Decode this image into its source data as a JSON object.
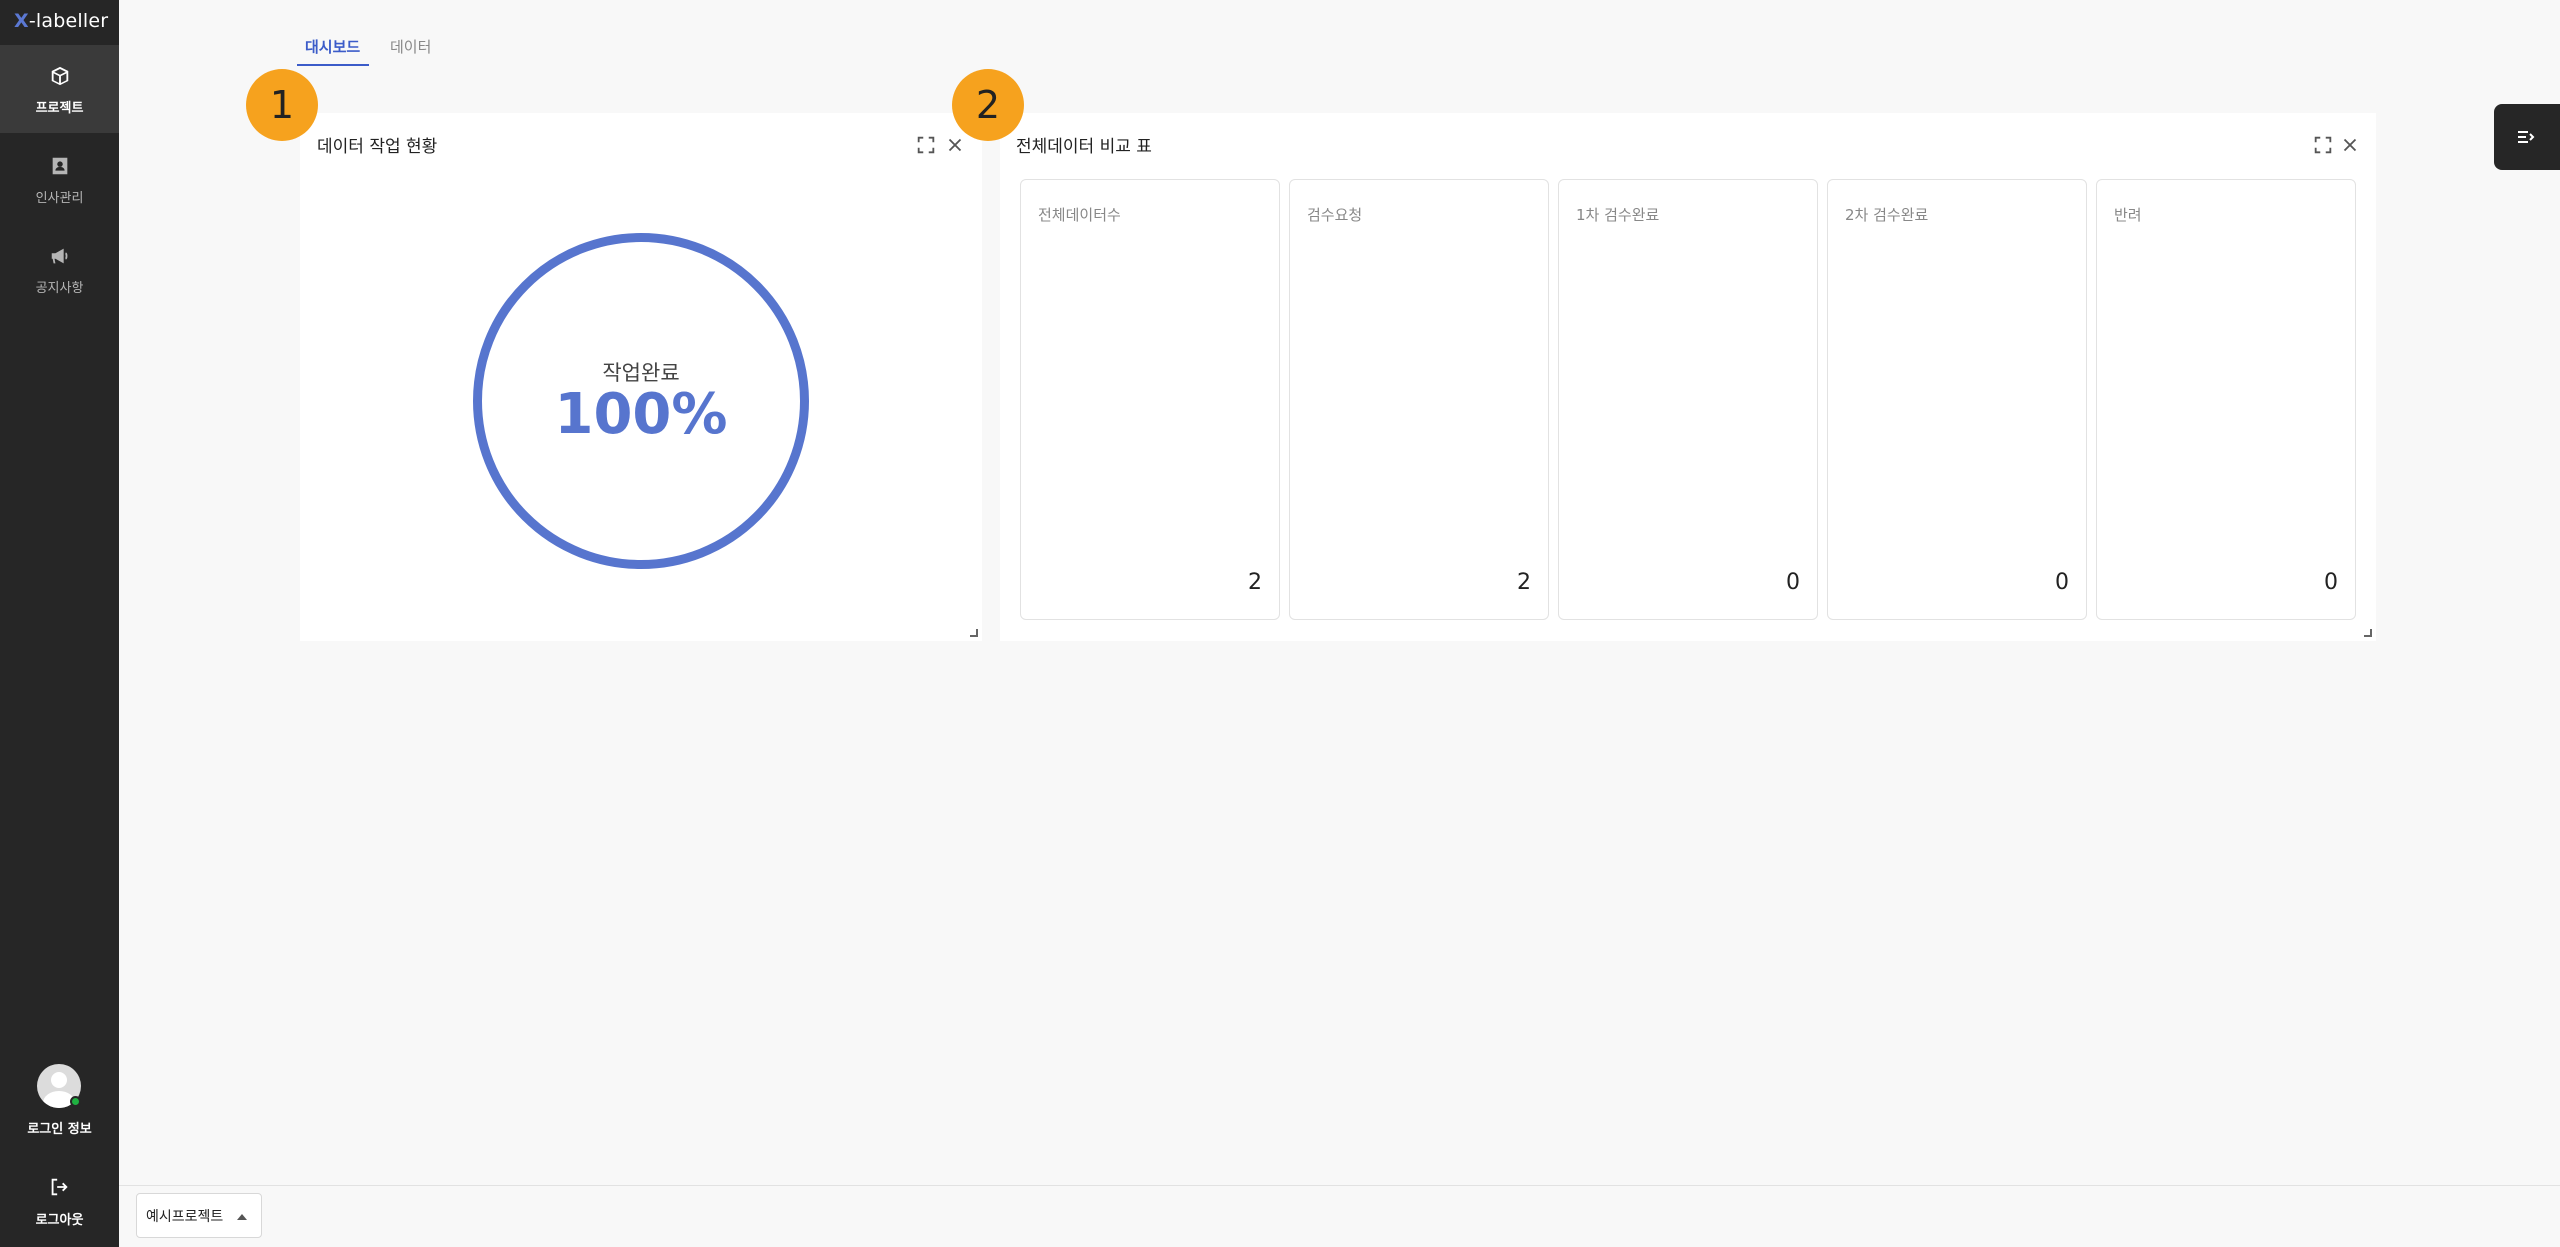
{
  "app": {
    "logo_prefix": "X",
    "logo_suffix": "-labeller",
    "brand_color": "#5b78d3"
  },
  "sidebar": {
    "items": [
      {
        "label": "프로젝트",
        "icon": "cube-icon",
        "active": true
      },
      {
        "label": "인사관리",
        "icon": "person-badge-icon",
        "active": false
      },
      {
        "label": "공지사항",
        "icon": "megaphone-icon",
        "active": false
      }
    ],
    "login_label": "로그인 정보",
    "logout_label": "로그아웃",
    "status_color": "#1fb141"
  },
  "tabs": [
    {
      "label": "대시보드",
      "active": true
    },
    {
      "label": "데이터",
      "active": false
    }
  ],
  "panels": [
    {
      "badge": "1",
      "title": "데이터 작업 현황",
      "progress": {
        "label": "작업완료",
        "value": "100%",
        "fraction": 1.0,
        "color": "#5775ce"
      }
    },
    {
      "badge": "2",
      "title": "전체데이터 비교 표",
      "cards": [
        {
          "label": "전체데이터수",
          "value": "2"
        },
        {
          "label": "검수요청",
          "value": "2"
        },
        {
          "label": "1차 검수완료",
          "value": "0"
        },
        {
          "label": "2차 검수완료",
          "value": "0"
        },
        {
          "label": "반려",
          "value": "0"
        }
      ]
    }
  ],
  "badge_color": "#f6a21e",
  "project_select": {
    "value": "예시프로젝트"
  }
}
